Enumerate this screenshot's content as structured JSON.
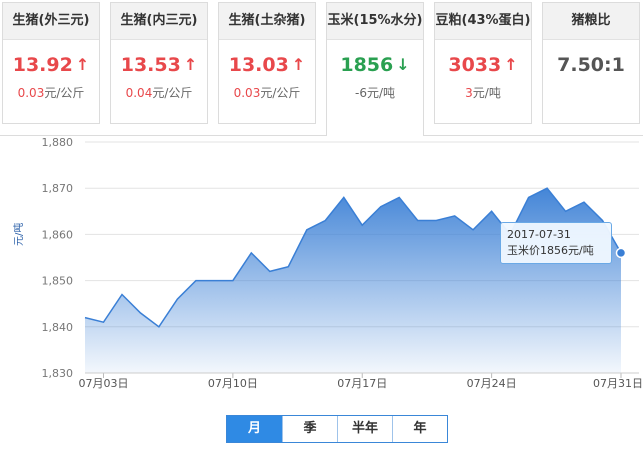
{
  "cards": [
    {
      "title": "生猪(外三元)",
      "price": "13.92",
      "arrow": "↑",
      "trend": "up",
      "change": "0.03",
      "unit": "元/公斤"
    },
    {
      "title": "生猪(内三元)",
      "price": "13.53",
      "arrow": "↑",
      "trend": "up",
      "change": "0.04",
      "unit": "元/公斤"
    },
    {
      "title": "生猪(土杂猪)",
      "price": "13.03",
      "arrow": "↑",
      "trend": "up",
      "change": "0.03",
      "unit": "元/公斤"
    },
    {
      "title": "玉米(15%水分)",
      "price": "1856",
      "arrow": "↓",
      "trend": "down",
      "change": "-6",
      "unit": "元/吨"
    },
    {
      "title": "豆粕(43%蛋白)",
      "price": "3033",
      "arrow": "↑",
      "trend": "up",
      "change": "3",
      "unit": "元/吨"
    },
    {
      "title": "猪粮比",
      "price": "7.50:1",
      "arrow": "",
      "trend": "neutral",
      "change": "",
      "unit": ""
    }
  ],
  "colors": {
    "up": "#e8484b",
    "down": "#2aa051",
    "accent": "#2f8ae4",
    "line": "#3a7fd5"
  },
  "tooltip": {
    "date": "2017-07-31",
    "label": "玉米价1856元/吨"
  },
  "tabs": [
    {
      "label": "月",
      "active": true
    },
    {
      "label": "季",
      "active": false
    },
    {
      "label": "半年",
      "active": false
    },
    {
      "label": "年",
      "active": false
    }
  ],
  "chart_data": {
    "type": "area",
    "ylabel": "元/吨",
    "ylim": [
      1830,
      1880
    ],
    "yticks": [
      "1,880",
      "1,870",
      "1,860",
      "1,850",
      "1,840",
      "1,830"
    ],
    "xticklabels": [
      "07月03日",
      "07月10日",
      "07月17日",
      "07月24日",
      "07月31日"
    ],
    "xtick_index": [
      1,
      8,
      15,
      22,
      29
    ],
    "values": [
      1842,
      1841,
      1847,
      1843,
      1840,
      1846,
      1850,
      1850,
      1850,
      1856,
      1852,
      1853,
      1861,
      1863,
      1868,
      1862,
      1866,
      1868,
      1863,
      1863,
      1864,
      1861,
      1865,
      1860,
      1868,
      1870,
      1865,
      1867,
      1863,
      1856
    ],
    "grid": true
  }
}
